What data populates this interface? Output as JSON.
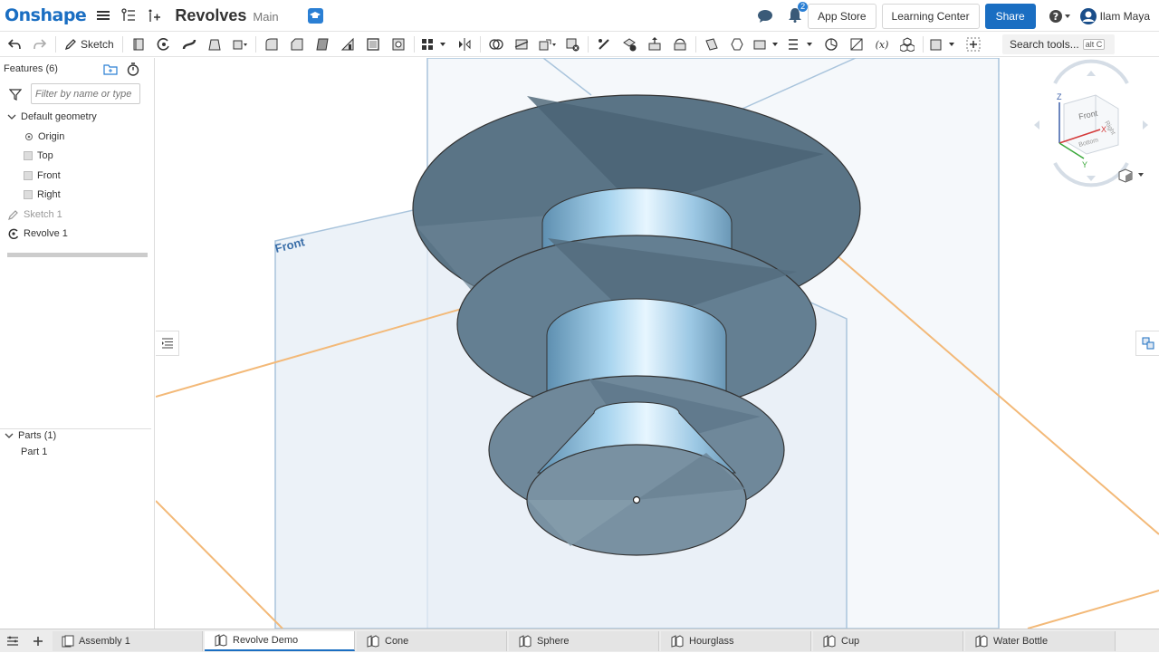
{
  "app": {
    "logo": "Onshape",
    "doc_title": "Revolves",
    "branch": "Main"
  },
  "topbar": {
    "app_store": "App Store",
    "learning_center": "Learning Center",
    "share": "Share",
    "notification_count": "2",
    "user_name": "Ilam Maya"
  },
  "toolbar": {
    "sketch_label": "Sketch",
    "search_tools": "Search tools...",
    "search_shortcut": "alt C"
  },
  "features": {
    "header": "Features (6)",
    "filter_placeholder": "Filter by name or type",
    "default_geometry": "Default geometry",
    "items": [
      {
        "label": "Origin"
      },
      {
        "label": "Top"
      },
      {
        "label": "Front"
      },
      {
        "label": "Right"
      }
    ],
    "sketch1": "Sketch 1",
    "revolve1": "Revolve 1"
  },
  "parts": {
    "header": "Parts (1)",
    "items": [
      {
        "label": "Part 1"
      }
    ]
  },
  "viewport": {
    "plane_label": "Front"
  },
  "viewcube": {
    "front": "Front",
    "right": "Right",
    "bottom": "Bottom",
    "axis_x": "X",
    "axis_y": "Y",
    "axis_z": "Z"
  },
  "tabs": [
    {
      "label": "Assembly 1",
      "icon": "assembly-icon"
    },
    {
      "label": "Revolve Demo",
      "icon": "partstudio-icon",
      "active": true
    },
    {
      "label": "Cone",
      "icon": "partstudio-icon"
    },
    {
      "label": "Sphere",
      "icon": "partstudio-icon"
    },
    {
      "label": "Hourglass",
      "icon": "partstudio-icon"
    },
    {
      "label": "Cup",
      "icon": "partstudio-icon"
    },
    {
      "label": "Water Bottle",
      "icon": "partstudio-icon"
    }
  ],
  "colors": {
    "brand": "#1a6ec2",
    "part_face": "#5f7a8c",
    "plane_edge": "#f3b978",
    "front_plane": "#a9c4dc"
  }
}
